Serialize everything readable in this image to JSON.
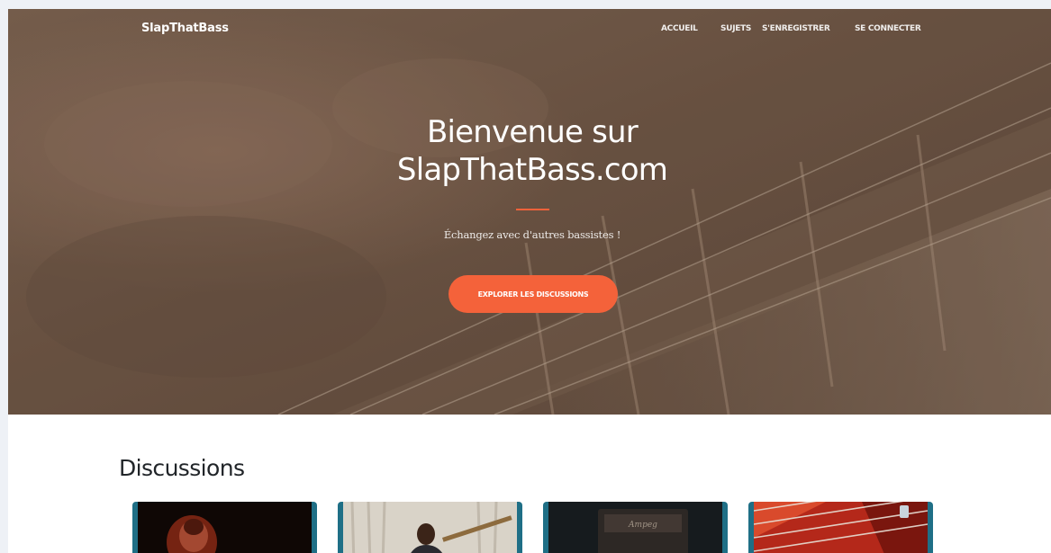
{
  "navbar": {
    "brand": "SlapThatBass",
    "links": [
      "ACCUEIL",
      "SUJETS",
      "S'ENREGISTRER",
      "SE CONNECTER"
    ]
  },
  "hero": {
    "title_line1": "Bienvenue sur",
    "title_line2": "SlapThatBass.com",
    "subtitle": "Échangez avec d'autres bassistes !",
    "button_label": "EXPLORER LES DISCUSSIONS"
  },
  "discussions": {
    "title": "Discussions",
    "cards": [
      {
        "image": "bassist-on-stage-photo"
      },
      {
        "image": "bassist-in-suit-photo"
      },
      {
        "image": "bass-amplifier-photo"
      },
      {
        "image": "red-bass-strings-photo"
      }
    ]
  },
  "colors": {
    "accent": "#f4623a",
    "hero_overlay": "#6e5646",
    "card_border": "#1f6f86",
    "text_dark": "#212529"
  }
}
